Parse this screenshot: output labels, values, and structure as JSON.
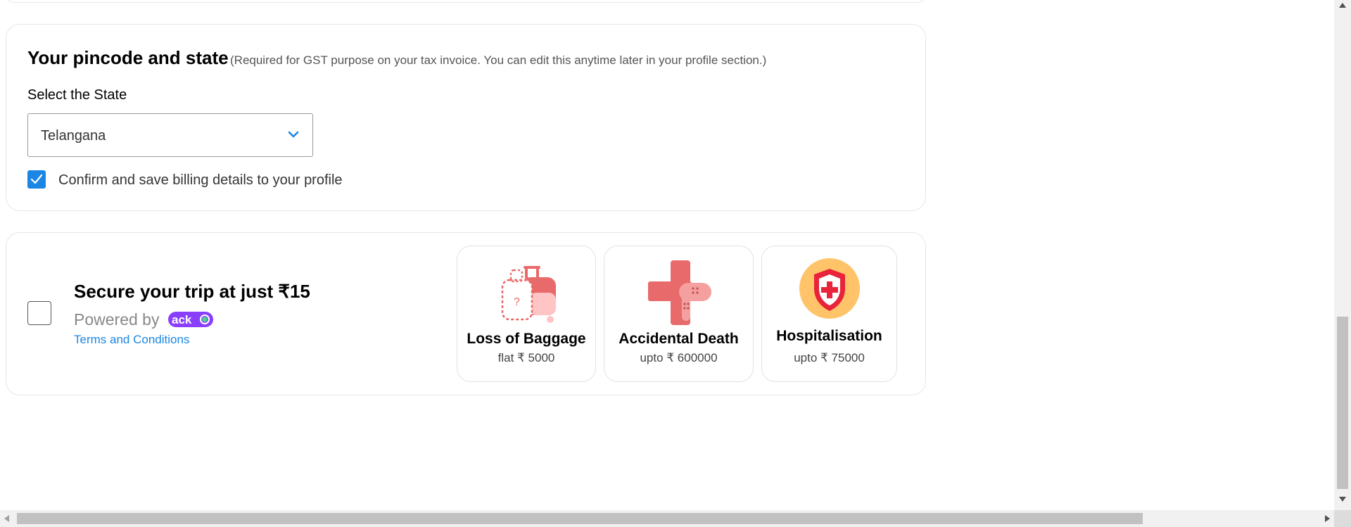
{
  "billing": {
    "title": "Your pincode and state",
    "note": "(Required for GST purpose on your tax invoice. You can edit this anytime later in your profile section.)",
    "state_label": "Select the State",
    "state_value": "Telangana",
    "confirm_checked": true,
    "confirm_label": "Confirm and save billing details to your profile"
  },
  "trip_insurance": {
    "checked": false,
    "title": "Secure your trip at just ₹15",
    "powered_by": "Powered by",
    "partner_logo": "acko",
    "terms_link": "Terms and Conditions",
    "benefits": [
      {
        "name": "Loss of Baggage",
        "amount": "flat ₹ 5000",
        "icon": "luggage-icon"
      },
      {
        "name": "Accidental Death",
        "amount": "upto ₹ 600000",
        "icon": "bandage-cross-icon"
      },
      {
        "name": "Hospitalisation",
        "amount": "upto ₹ 75000",
        "icon": "medical-shield-icon"
      }
    ]
  },
  "colors": {
    "accent": "#1b86e3",
    "acko_brand": "#8a3ffc",
    "card_border": "#e6e6e6",
    "benefit_red": "#e86a6a",
    "shield_bg": "#ffc469",
    "shield_red": "#e8233a"
  }
}
